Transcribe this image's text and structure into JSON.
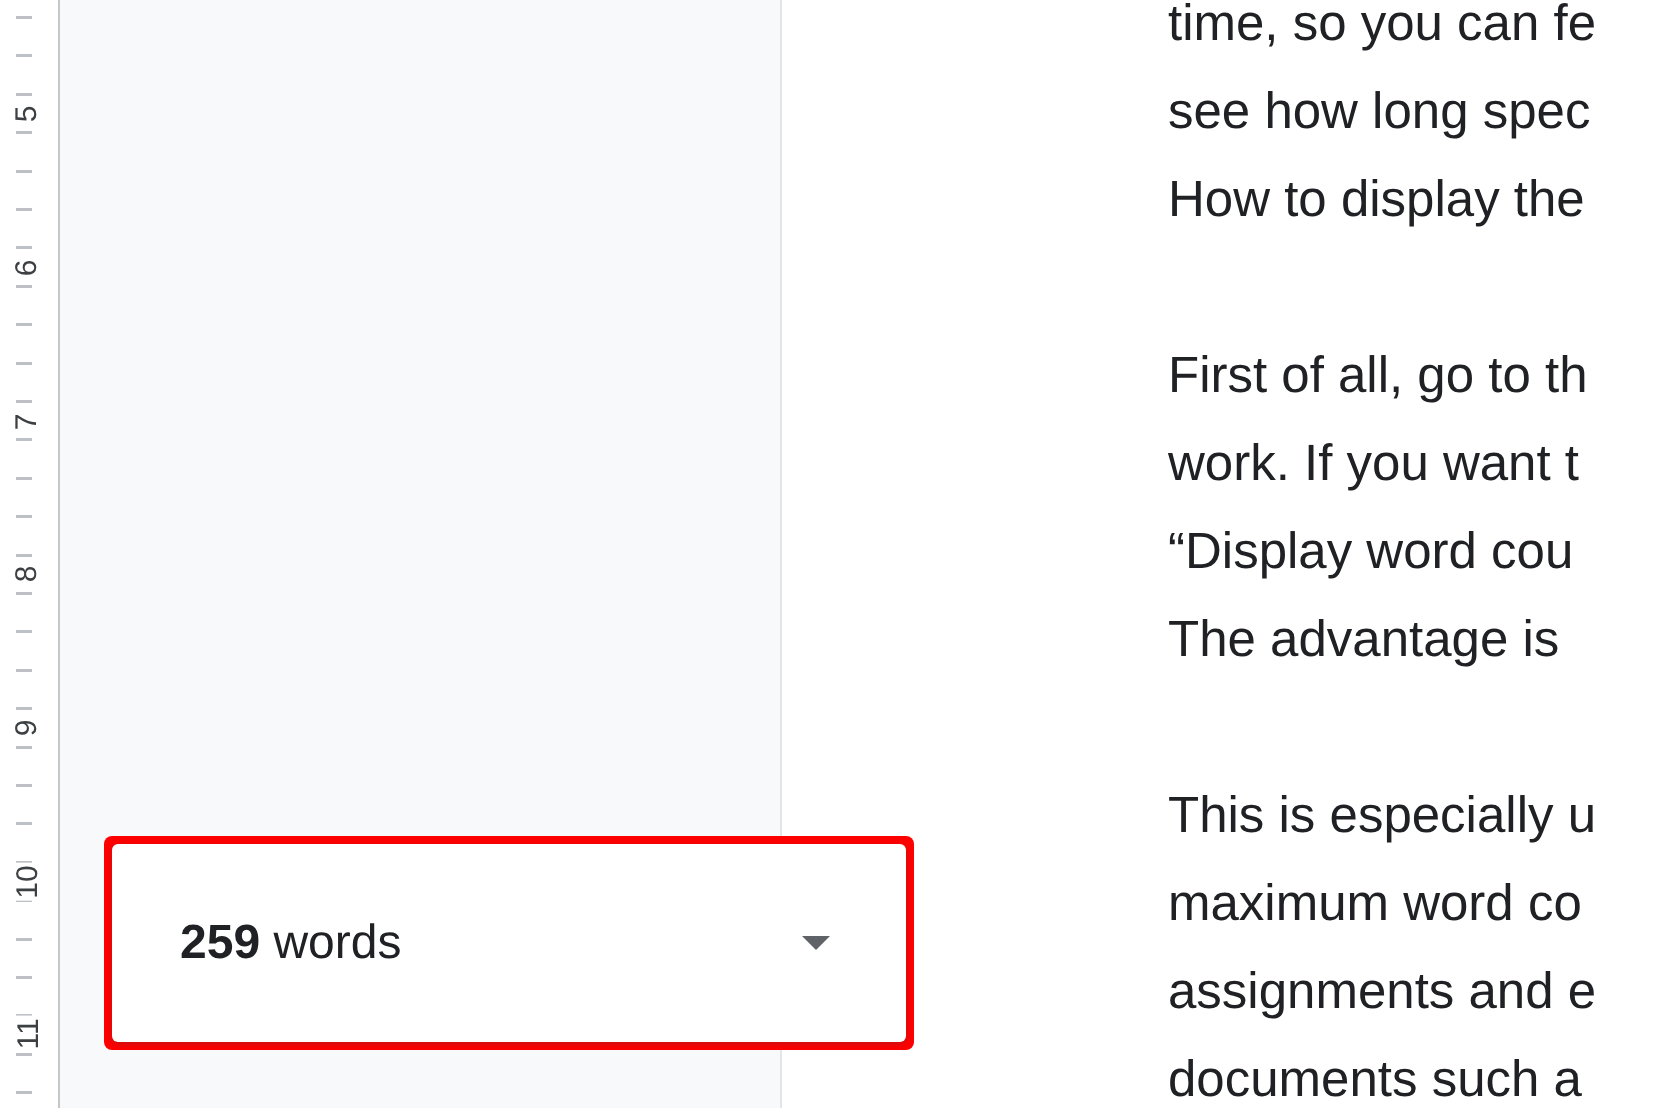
{
  "ruler": {
    "numbers": [
      "5",
      "6",
      "7",
      "8",
      "9",
      "10",
      "11"
    ]
  },
  "word_count": {
    "text": "**259** words",
    "highlighted": true
  },
  "document": {
    "paragraphs": [
      {
        "lines": [
          "time, so you can fe",
          "see how long spec",
          "How to display the"
        ]
      },
      {
        "lines": [
          "First of all, go to th",
          "work. If you want t",
          "“Display word cou",
          "The advantage is"
        ]
      },
      {
        "lines": [
          "This is especially u",
          "maximum word co",
          "assignments and e",
          "documents such a"
        ]
      }
    ]
  }
}
